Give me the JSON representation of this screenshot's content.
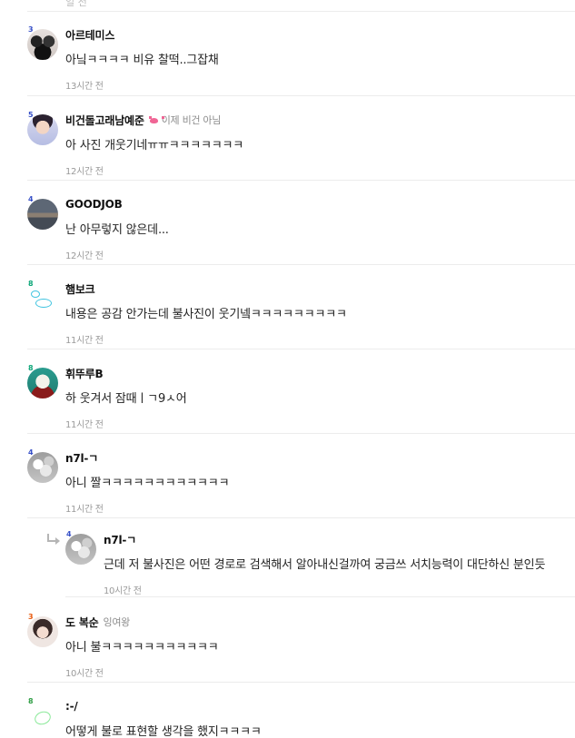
{
  "top_fragment": "일 전",
  "comments": [
    {
      "name": "아르테미스",
      "level": "3",
      "text": "아닠ㅋㅋㅋㅋ 비유 찰떡..그잡채",
      "time": "13시간 전",
      "tag": ""
    },
    {
      "name": "비건돌고래남예준",
      "level": "5",
      "text": "아 사진 개웃기네ㅠㅠㅋㅋㅋㅋㅋㅋㅋ",
      "time": "12시간 전",
      "tag": "이제 비건 아님",
      "tag_icon": "crab-icon"
    },
    {
      "name": "GOODJOB",
      "level": "4",
      "text": "난 아무렇지 않은데...",
      "time": "12시간 전",
      "tag": ""
    },
    {
      "name": "햄보크",
      "level": "8",
      "text": "내용은 공감 안가는데 불사진이 웃기넼ㅋㅋㅋㅋㅋㅋㅋㅋㅋ",
      "time": "11시간 전",
      "tag": ""
    },
    {
      "name": "휘뚜루B",
      "level": "8",
      "text": "하 웃겨서 잠때ㅣㄱ9ㅅ어",
      "time": "11시간 전",
      "tag": ""
    },
    {
      "name": "n7l-ㄱ",
      "level": "4",
      "text": "아니 짤ㅋㅋㅋㅋㅋㅋㅋㅋㅋㅋㅋㅋ",
      "time": "11시간 전",
      "tag": ""
    },
    {
      "name": "n7l-ㄱ",
      "level": "4",
      "text": "근데 저 불사진은 어떤 경로로 검색해서 알아내신걸까여 궁금쓰 서치능력이 대단하신 분인듯",
      "time": "10시간 전",
      "tag": "",
      "is_reply": true
    },
    {
      "name": "도 복순",
      "level": "3",
      "text": "아니 불ㅋㅋㅋㅋㅋㅋㅋㅋㅋㅋㅋ",
      "time": "10시간 전",
      "tag": "잉여왕"
    },
    {
      "name": ":-/",
      "level": "8",
      "text": "어떻게 불로 표현할 생각을 했지ㅋㅋㅋㅋ",
      "time": "",
      "tag": ""
    }
  ],
  "colors": {
    "level_blue": "#3b5bdb",
    "level_teal": "#0ca678",
    "tag_crab": "#f06595",
    "divider": "#ececec"
  }
}
